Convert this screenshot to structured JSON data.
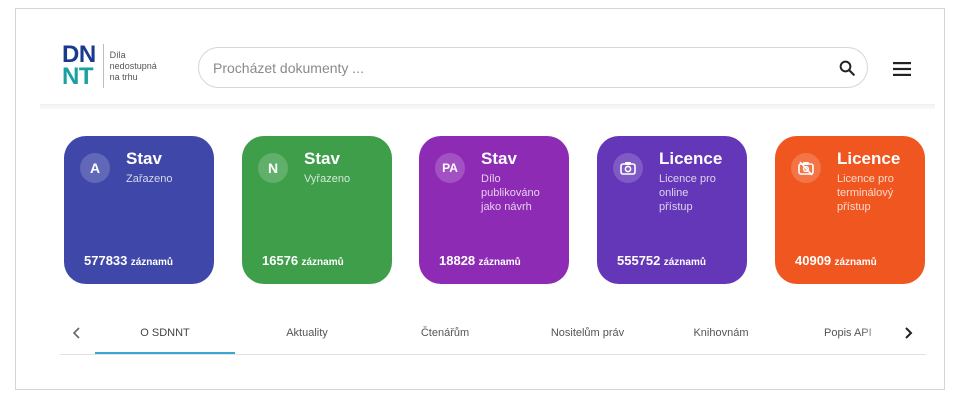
{
  "logo": {
    "letters_row1": "DN",
    "letters_row2": "NT",
    "text_line1": "Díla",
    "text_line2": "nedostupná",
    "text_line3": "na trhu"
  },
  "search": {
    "placeholder": "Procházet dokumenty ...",
    "value": ""
  },
  "icons": {
    "search": "search-icon",
    "menu": "hamburger-menu-icon",
    "prev": "chevron-left-icon",
    "next": "chevron-right-icon"
  },
  "cards": [
    {
      "badge": "A",
      "title": "Stav",
      "subtitle": "Zařazeno",
      "count": "577833",
      "unit": "záznamů",
      "color": "#3f47a8"
    },
    {
      "badge": "N",
      "title": "Stav",
      "subtitle": "Vyřazeno",
      "count": "16576",
      "unit": "záznamů",
      "color": "#3e9e4a"
    },
    {
      "badge": "PA",
      "title": "Stav",
      "subtitle": "Dílo publikováno jako návrh",
      "count": "18828",
      "unit": "záznamů",
      "color": "#8e2bb5"
    },
    {
      "badge_icon": "camera-icon",
      "title": "Licence",
      "subtitle": "Licence pro online přístup",
      "count": "555752",
      "unit": "záznamů",
      "color": "#6436b8"
    },
    {
      "badge_icon": "no-camera-icon",
      "title": "Licence",
      "subtitle": "Licence pro terminálový přístup",
      "count": "40909",
      "unit": "záznamů",
      "color": "#f0561f"
    }
  ],
  "tabs": [
    {
      "label": "O SDNNT",
      "active": true
    },
    {
      "label": "Aktuality",
      "active": false
    },
    {
      "label": "Čtenářům",
      "active": false
    },
    {
      "label": "Nositelům práv",
      "active": false
    },
    {
      "label": "Knihovnám",
      "active": false
    },
    {
      "label": "Popis API",
      "active": false
    }
  ],
  "colors": {
    "accent": "#3aa7cf",
    "logo_blue": "#1a3a8e",
    "logo_teal": "#1aa0a0"
  }
}
